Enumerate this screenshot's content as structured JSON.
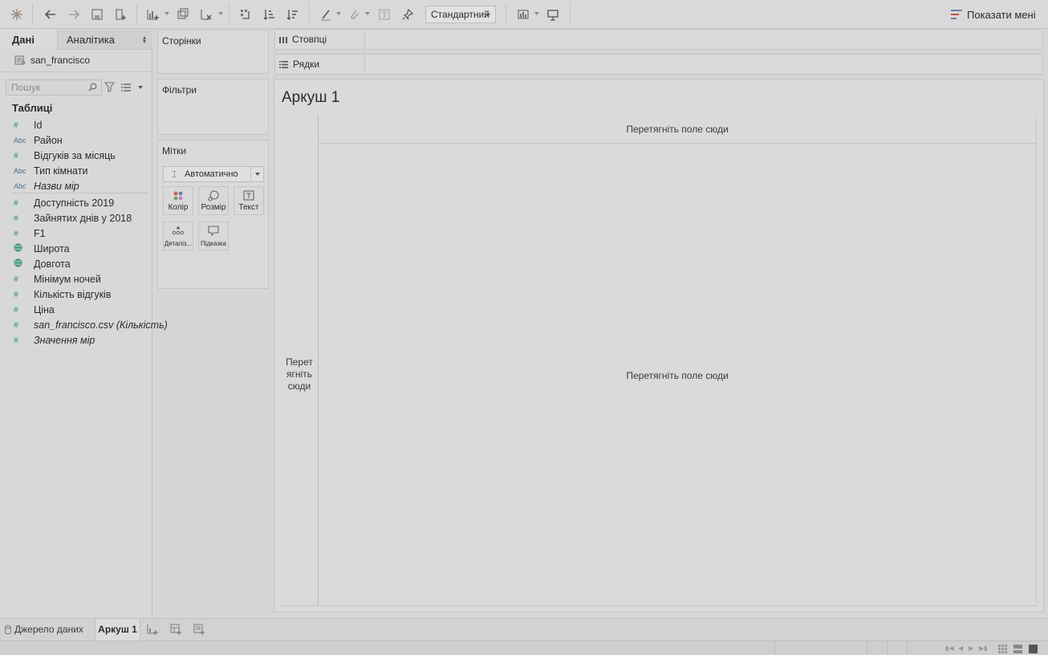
{
  "toolbar": {
    "standard_label": "Стандартний",
    "show_menu_label": "Показати мені"
  },
  "data_pane": {
    "tab_data": "Дані",
    "tab_analytics": "Аналітика",
    "datasource": "san_francisco",
    "search_placeholder": "Пошук",
    "tables_title": "Таблиці",
    "fields": [
      {
        "type": "#",
        "name": "Id",
        "italic": false
      },
      {
        "type": "Abc",
        "name": "Район",
        "italic": false
      },
      {
        "type": "#",
        "name": "Відгуків за місяць",
        "italic": false
      },
      {
        "type": "Abc",
        "name": "Тип кімнати",
        "italic": false
      },
      {
        "type": "Abc",
        "name": "Назви мір",
        "italic": true
      },
      {
        "type": "#",
        "name": "Доступність 2019",
        "italic": false
      },
      {
        "type": "#",
        "name": "Зайнятих днів у 2018",
        "italic": false
      },
      {
        "type": "#",
        "name": "F1",
        "italic": false
      },
      {
        "type": "geo",
        "name": "Широта",
        "italic": false
      },
      {
        "type": "geo",
        "name": "Довгота",
        "italic": false
      },
      {
        "type": "#",
        "name": "Мінімум ночей",
        "italic": false
      },
      {
        "type": "#",
        "name": "Кількість відгуків",
        "italic": false
      },
      {
        "type": "#",
        "name": "Ціна",
        "italic": false
      },
      {
        "type": "#",
        "name": "san_francisco.csv (Кількість)",
        "italic": true
      },
      {
        "type": "#",
        "name": "Значення мір",
        "italic": true
      }
    ]
  },
  "cards": {
    "pages": "Сторінки",
    "filters": "Фільтри",
    "marks": "Мітки",
    "marks_type": "Автоматично",
    "color": "Колір",
    "size": "Розмір",
    "text": "Текст",
    "detail": "Деталіз...",
    "tooltip": "Підказка"
  },
  "shelves": {
    "columns": "Стовпці",
    "rows": "Рядки"
  },
  "canvas": {
    "sheet_title": "Аркуш 1",
    "drop_columns": "Перетягніть поле сюди",
    "drop_main": "Перетягніть поле сюди",
    "drop_rows_line1": "Перет",
    "drop_rows_line2": "ягніть",
    "drop_rows_line3": "сюди"
  },
  "tabs": {
    "data_source": "Джерело даних",
    "sheet1": "Аркуш 1"
  }
}
